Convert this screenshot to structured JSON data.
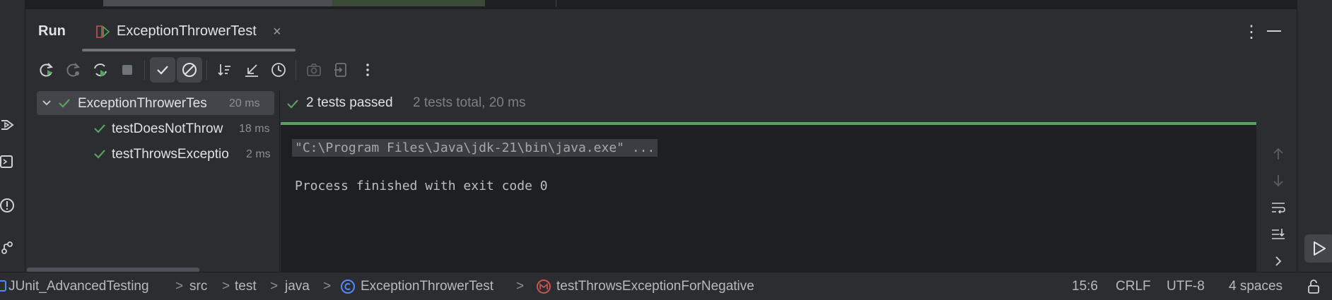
{
  "toolwindow": {
    "title": "Run",
    "tab_label": "ExceptionThrowerTest",
    "close_glyph": "×",
    "more_glyph": "⋮"
  },
  "tree": {
    "root": {
      "name": "ExceptionThrowerTes",
      "time": "20 ms"
    },
    "children": [
      {
        "name": "testDoesNotThrow",
        "time": "18 ms"
      },
      {
        "name": "testThrowsExceptio",
        "time": "2 ms"
      }
    ]
  },
  "console": {
    "passed": "2 tests passed",
    "total": "2 tests total, 20 ms",
    "command": "\"C:\\Program Files\\Java\\jdk-21\\bin\\java.exe\" ...",
    "output": "Process finished with exit code 0",
    "progress": 1.0
  },
  "statusbar": {
    "crumbs": [
      "JUnit_AdvancedTesting",
      "src",
      "test",
      "java",
      "ExceptionThrowerTest",
      "testThrowsExceptionForNegative"
    ],
    "crumb_sep": ">",
    "position": "15:6",
    "line_ending": "CRLF",
    "encoding": "UTF-8",
    "indent": "4 spaces"
  },
  "colors": {
    "accent_green": "#5aa05e",
    "panel_bg": "#2b2d30",
    "editor_bg": "#1e1f22"
  },
  "icons": {
    "toolbar": [
      "rerun-icon",
      "rerun-failed-icon",
      "toggle-auto-test-icon",
      "stop-icon",
      "show-passed-icon",
      "show-ignored-icon",
      "sort-icon",
      "collapse-icon",
      "history-icon",
      "camera-icon",
      "export-icon",
      "more-icon"
    ]
  }
}
